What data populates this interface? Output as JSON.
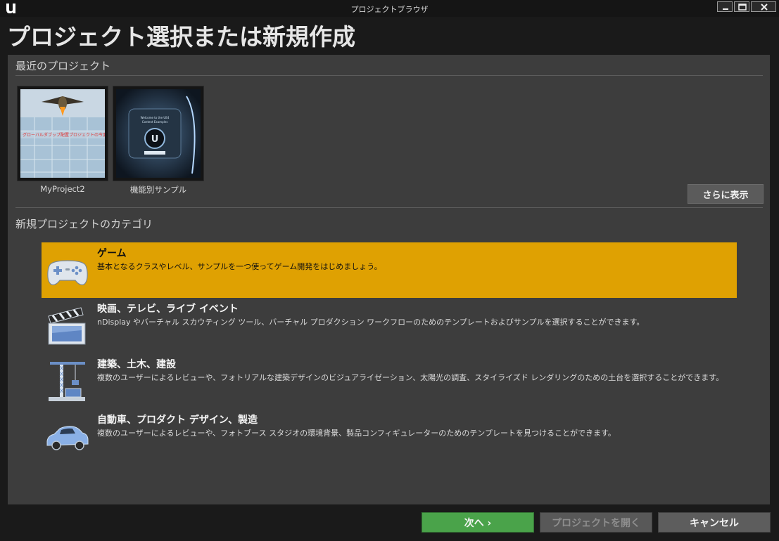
{
  "window": {
    "title": "プロジェクトブラウザ",
    "controls": [
      "minimize",
      "maximize",
      "close"
    ]
  },
  "header": {
    "title": "プロジェクト選択または新規作成"
  },
  "recent": {
    "section_label": "最近のプロジェクト",
    "projects": [
      {
        "name": "MyProject2",
        "thumbnail_caption": "グローバルダブップ配置プロジェクトの今度を測定",
        "icon": "project-thumbnail-aircraft"
      },
      {
        "name": "機能別サンプル",
        "thumbnail_caption": "Content Examples",
        "icon": "project-thumbnail-ue-logo"
      }
    ],
    "more_button": "さらに表示"
  },
  "categories": {
    "section_label": "新規プロジェクトのカテゴリ",
    "items": [
      {
        "title": "ゲーム",
        "description": "基本となるクラスやレベル、サンプルを一つ使ってゲーム開発をはじめましょう。",
        "icon": "gamepad-icon",
        "selected": true
      },
      {
        "title": "映画、テレビ、ライブ イベント",
        "description": "nDisplay やバーチャル スカウティング ツール、バーチャル プロダクション ワークフローのためのテンプレートおよびサンプルを選択することができます。",
        "icon": "clapperboard-icon",
        "selected": false
      },
      {
        "title": "建築、土木、建設",
        "description": "複数のユーザーによるレビューや、フォトリアルな建築デザインのビジュアライゼーション、太陽光の調査、スタイライズド レンダリングのための土台を選択することができます。",
        "icon": "crane-icon",
        "selected": false
      },
      {
        "title": "自動車、プロダクト デザイン、製造",
        "description": "複数のユーザーによるレビューや、フォトブース スタジオの環境背景、製品コンフィギュレーターのためのテンプレートを見つけることができます。",
        "icon": "car-icon",
        "selected": false
      }
    ]
  },
  "footer": {
    "next": "次へ ›",
    "open": "プロジェクトを開く",
    "cancel": "キャンセル"
  },
  "colors": {
    "selected_category": "#dfa102",
    "next_button": "#4aa34a",
    "panel": "#3d3d3d"
  }
}
